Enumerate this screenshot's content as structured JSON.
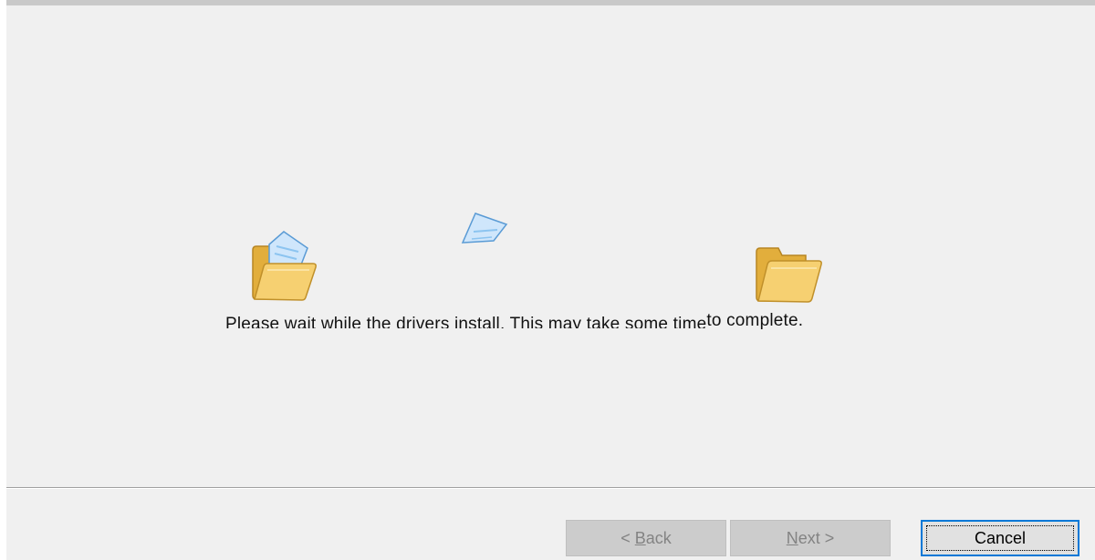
{
  "window": {
    "content": {
      "status_message_prefix": "Please wait while the drivers install. This may take some time",
      "status_message_suffix": " to complete."
    },
    "animation": {
      "source_icon": "open-folder-with-document-icon",
      "moving_icon": "flying-document-icon",
      "destination_icon": "folder-icon"
    },
    "buttons": {
      "back": {
        "lt": "< ",
        "mnemonic": "B",
        "rest": "ack",
        "enabled": false
      },
      "next": {
        "mnemonic": "N",
        "rest": "ext >",
        "enabled": false
      },
      "cancel": {
        "label": "Cancel",
        "enabled": true,
        "focused": true
      }
    }
  },
  "colors": {
    "dialog_background": "#f0f0f0",
    "disabled_button_background": "#cccccc",
    "disabled_button_text": "#838383",
    "focus_border": "#0078d7",
    "folder_yellow": "#f3c65a",
    "document_blue": "#8cc4f0"
  }
}
